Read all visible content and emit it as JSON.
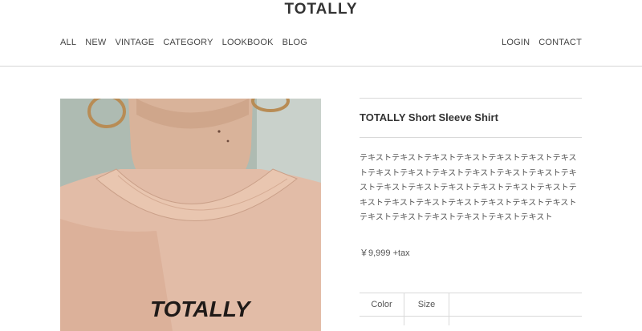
{
  "header": {
    "logo": "TOTALLY",
    "nav_left": [
      "ALL",
      "NEW",
      "VINTAGE",
      "CATEGORY",
      "LOOKBOOK",
      "BLOG"
    ],
    "nav_right": [
      "LOGIN",
      "CONTACT"
    ]
  },
  "product": {
    "image_print_text": "TOTALLY",
    "title": "TOTALLY Short Sleeve Shirt",
    "description": "テキストテキストテキストテキストテキストテキストテキストテキストテキストテキストテキストテキストテキストテキストテキストテキストテキストテキストテキストテキストテキストテキストテキストテキストテキストテキストテキストテキストテキストテキストテキストテキストテキスト",
    "price": "￥9,999 +tax",
    "options": {
      "color_label": "Color",
      "size_label": "Size"
    }
  }
}
